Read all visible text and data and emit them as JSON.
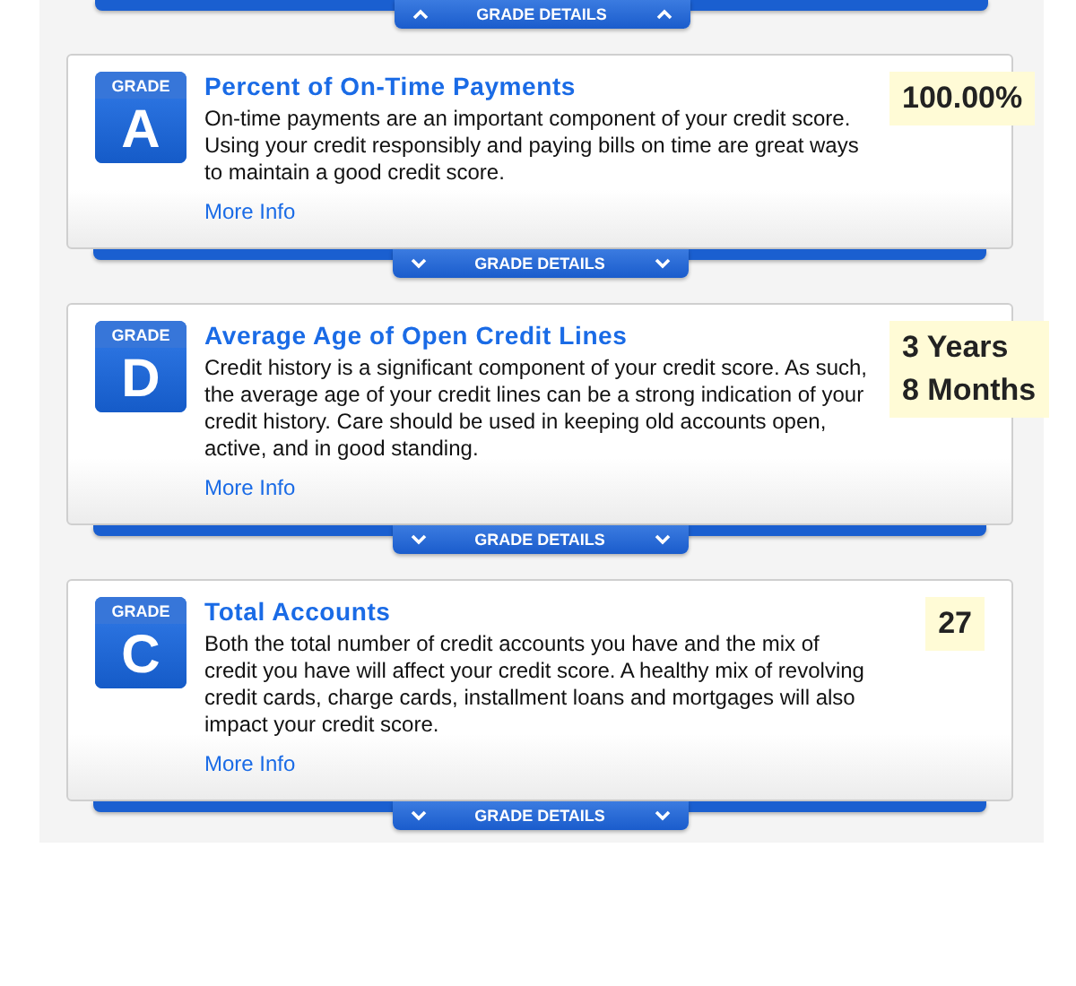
{
  "top_toggle": {
    "label": "GRADE DETAILS",
    "expanded": true
  },
  "factors": [
    {
      "grade_label": "GRADE",
      "grade": "A",
      "title": "Percent of On-Time Payments",
      "description": "On-time payments are an important component of your credit score. Using your credit responsibly and paying bills on time are great ways to maintain a good credit score.",
      "link": "More Info",
      "value_lines": [
        "100.00%"
      ],
      "toggle": {
        "label": "GRADE DETAILS",
        "expanded": false
      }
    },
    {
      "grade_label": "GRADE",
      "grade": "D",
      "title": "Average Age of Open Credit Lines",
      "description": "Credit history is a significant component of your credit score. As such, the average age of your credit lines can be a strong indication of your credit history. Care should be used in keeping old accounts open, active, and in good standing.",
      "link": "More Info",
      "value_lines": [
        "3 Years",
        "8 Months"
      ],
      "toggle": {
        "label": "GRADE DETAILS",
        "expanded": false
      }
    },
    {
      "grade_label": "GRADE",
      "grade": "C",
      "title": "Total Accounts",
      "description": "Both the total number of credit accounts you have and the mix of credit you have will affect your credit score. A healthy mix of revolving credit cards, charge cards, installment loans and mortgages will also impact your credit score.",
      "link": "More Info",
      "value_lines": [
        "27"
      ],
      "toggle": {
        "label": "GRADE DETAILS",
        "expanded": false
      }
    }
  ]
}
